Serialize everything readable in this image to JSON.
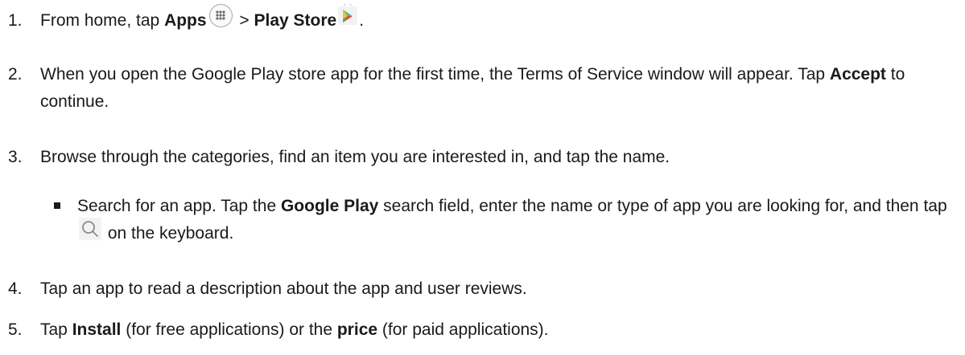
{
  "steps": [
    {
      "num": "1.",
      "pre": "From home, tap ",
      "apps": "Apps",
      "sep": " > ",
      "store": "Play Store",
      "post": "."
    },
    {
      "num": "2.",
      "pre": "When you open the Google Play store app for the first time, the Terms of Service window will appear. Tap ",
      "bold": "Accept",
      "post": " to continue."
    },
    {
      "num": "3.",
      "text": "Browse through the categories, find an item you are interested in, and tap the name."
    },
    {
      "num": "4.",
      "text": "Tap an app to read a description about the app and user reviews."
    },
    {
      "num": "5.",
      "pre": "Tap ",
      "bold1": "Install",
      "mid": " (for free applications) or the ",
      "bold2": "price",
      "post": " (for paid applications)."
    }
  ],
  "bullet": {
    "pre": "Search for an app. Tap the ",
    "bold": "Google Play",
    "mid": " search field, enter the name or type of app you are looking for, and then tap ",
    "post": " on the keyboard."
  },
  "icons": {
    "apps": "apps-icon",
    "play_store": "play-store-icon",
    "search": "search-icon"
  }
}
